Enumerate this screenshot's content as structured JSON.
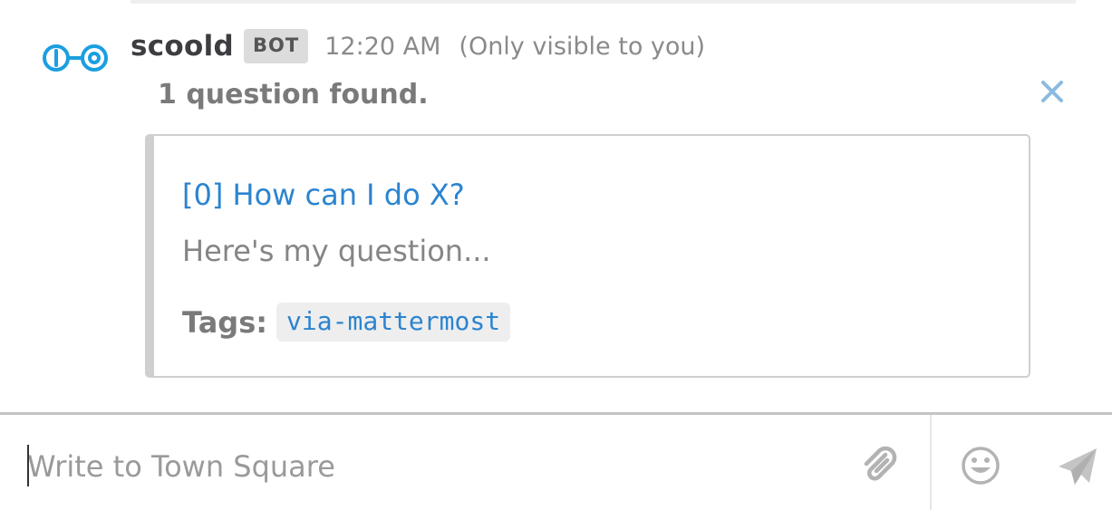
{
  "message": {
    "username": "scoold",
    "badge": "BOT",
    "timestamp": "12:20 AM",
    "visibility_note": "(Only visible to you)",
    "summary": "1 question found."
  },
  "attachment": {
    "title": "[0] How can I do X?",
    "text": "Here's my question...",
    "tags_label": "Tags:",
    "tags": [
      "via-mattermost"
    ]
  },
  "composer": {
    "placeholder": "Write to Town Square"
  },
  "icons": {
    "avatar": "scoold-logo-icon",
    "close": "close-icon",
    "attach": "paperclip-icon",
    "emoji": "smiley-icon",
    "send": "send-icon"
  },
  "colors": {
    "link": "#2b84d0",
    "avatar": "#1a9fe0",
    "close": "#8bbbe0",
    "icon_gray": "#b3b3b3"
  }
}
